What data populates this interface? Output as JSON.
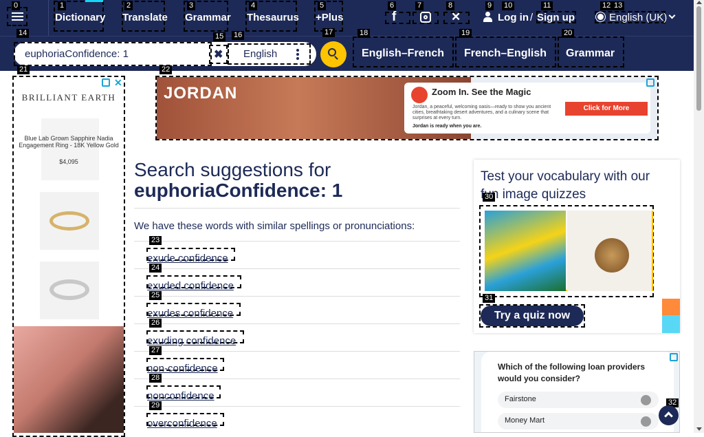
{
  "nav": {
    "menu_icon": "hamburger-icon",
    "items": [
      {
        "num": "1",
        "label": "Dictionary"
      },
      {
        "num": "2",
        "label": "Translate"
      },
      {
        "num": "3",
        "label": "Grammar"
      },
      {
        "num": "4",
        "label": "Thesaurus"
      },
      {
        "num": "5",
        "label": "+Plus"
      }
    ],
    "social": [
      {
        "num": "6",
        "icon": "facebook-icon",
        "glyph": "f"
      },
      {
        "num": "7",
        "icon": "instagram-icon",
        "glyph": "◎"
      },
      {
        "num": "8",
        "icon": "x-twitter-icon",
        "glyph": "𝕏"
      }
    ],
    "login_num": "9",
    "login": "Log in",
    "sep": "/",
    "signup_num": "11",
    "signup": "Sign up",
    "num10": "10",
    "lang_num": "12",
    "lang_num2": "13",
    "language": "English (UK)",
    "num0": "0"
  },
  "search": {
    "num": "14",
    "value": "euphoriaConfidence: 1",
    "clear_num": "15",
    "lang_num": "16",
    "lang": "English",
    "go_num": "17",
    "tabs": [
      {
        "num": "18",
        "label": "English–French"
      },
      {
        "num": "19",
        "label": "French–English"
      },
      {
        "num": "20",
        "label": "Grammar"
      }
    ]
  },
  "left_ad": {
    "num": "21",
    "brand": "BRILLIANT EARTH",
    "product": "Blue Lab Grown Sapphire Nadia Engagement Ring - 18K Yellow Gold",
    "price": "$4,095"
  },
  "top_ad": {
    "num": "22",
    "brand": "JORDAN",
    "headline": "Zoom In. See the Magic",
    "body": "Jordan, a peaceful, welcoming oasis—ready to show you ancient cities, breathtaking desert adventures, and a culinary scene that surprises at every turn.",
    "tagline": "Jordan is ready when you are.",
    "cta": "Click for More"
  },
  "main": {
    "heading": "Search suggestions for",
    "query": "euphoriaConfidence: 1",
    "intro": "We have these words with similar spellings or pronunciations:",
    "suggestions": [
      {
        "num": "23",
        "text": "exude confidence"
      },
      {
        "num": "24",
        "text": "exuded confidence"
      },
      {
        "num": "25",
        "text": "exudes confidence"
      },
      {
        "num": "26",
        "text": "exuding confidence"
      },
      {
        "num": "27",
        "text": "non-confidence"
      },
      {
        "num": "28",
        "text": "nonconfidence"
      },
      {
        "num": "29",
        "text": "overconfidence"
      }
    ]
  },
  "quiz": {
    "title": "Test your vocabulary with our fun image quizzes",
    "img_num": "30",
    "btn_num": "31",
    "btn": "Try a quiz now"
  },
  "bottom_ad": {
    "question": "Which of the following loan providers would you consider?",
    "options": [
      "Fairstone",
      "Money Mart"
    ]
  },
  "scroll_top_num": "32"
}
